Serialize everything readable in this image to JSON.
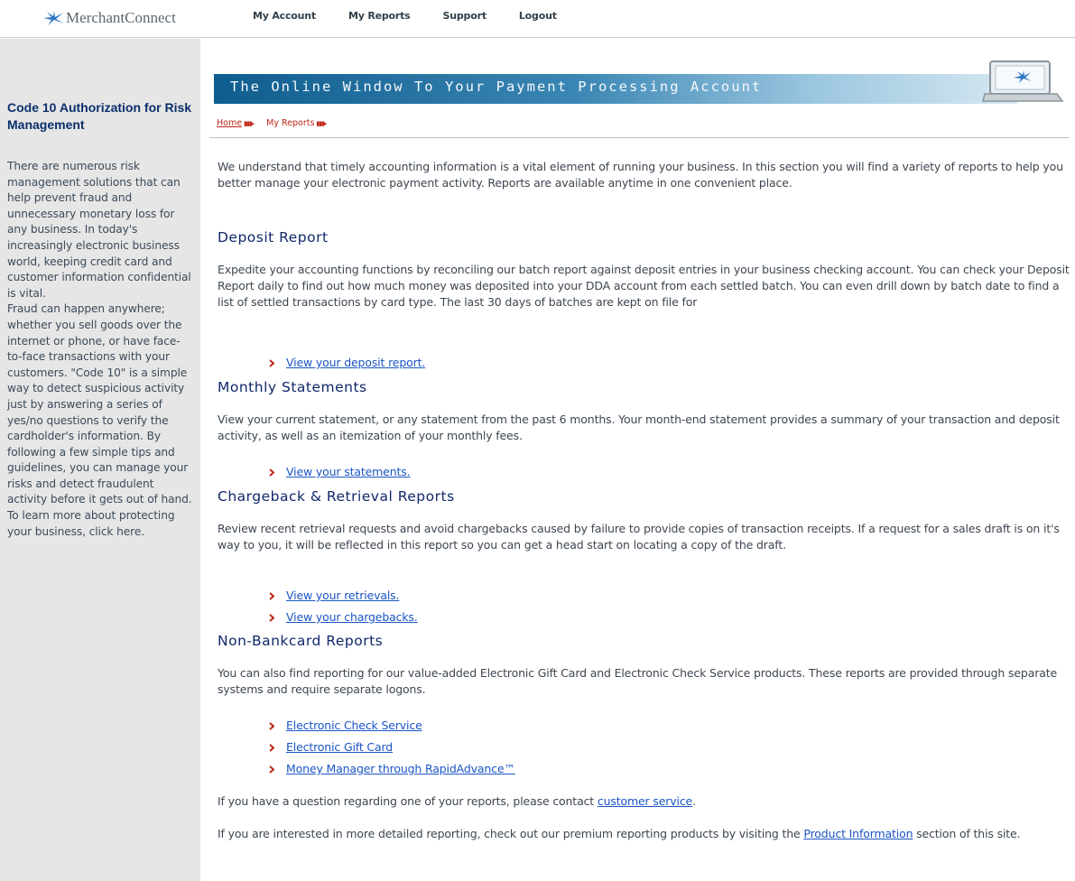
{
  "header": {
    "logo_text": "MerchantConnect",
    "nav": [
      "My Account",
      "My Reports",
      "Support",
      "Logout"
    ]
  },
  "sidebar": {
    "title": "Code 10 Authorization for Risk Management",
    "para1": "There are numerous risk management solutions that can help prevent fraud and unnecessary monetary loss for any business. In today's increasingly electronic business world, keeping credit card and customer information confidential is vital.",
    "para2": "Fraud can happen anywhere; whether you sell goods over the internet or phone, or have face-to-face transactions with your customers. \"Code 10\" is a simple way to detect suspicious activity just by answering a series of yes/no questions to verify the cardholder's information. By following a few simple tips and guidelines, you can manage your risks and detect fraudulent activity before it gets out of hand. To learn more about protecting your business, click here."
  },
  "banner": {
    "text": "The Online Window To Your Payment Processing Account"
  },
  "breadcrumb": {
    "home": "Home",
    "reports": "My Reports"
  },
  "main": {
    "intro": "We understand that timely accounting information is a vital element of running your business. In this section you will find a variety of reports to help you better manage your electronic payment activity. Reports are available anytime in one convenient place.",
    "deposit": {
      "heading": "Deposit Report",
      "body": "Expedite your accounting functions by reconciling our batch report against deposit entries in your business checking account. You can check your Deposit Report daily to find out how much money was deposited into your DDA account from each settled batch. You can even drill down by batch date to find a list of settled transactions by card type. The last 30 days of batches are kept on file for",
      "link": "View your deposit report."
    },
    "monthly": {
      "heading": "Monthly Statements",
      "body": "View your current statement, or any statement from the past 6 months. Your month-end statement provides a summary of your transaction and deposit activity, as well as an itemization of your monthly fees.",
      "link": "View your statements."
    },
    "chargeback": {
      "heading": "Chargeback & Retrieval Reports",
      "body": "Review recent retrieval requests and avoid chargebacks caused by failure to provide copies of transaction receipts. If a request for a sales draft is on it's way to you, it will be reflected in this report so you can get a head start on locating a copy of the draft.",
      "link1": "View your retrievals.",
      "link2": "View your chargebacks."
    },
    "nonbank": {
      "heading": "Non-Bankcard Reports",
      "body": "You can also find reporting for our value-added Electronic Gift Card and Electronic Check Service products. These reports are provided through separate systems and require separate logons.",
      "link1": "Electronic Check Service",
      "link2": "Electronic Gift Card",
      "link3": "Money Manager through RapidAdvance™"
    },
    "question": {
      "prefix": "If you have a question regarding one of your reports, please contact ",
      "link": "customer service",
      "suffix": "."
    },
    "premium": {
      "prefix": "If you are interested in more detailed reporting, check out our premium reporting products by visiting the ",
      "link": "Product Information",
      "suffix": " section of this site."
    }
  },
  "colors": {
    "nav_text": "#33404a",
    "sidebar_bg": "#e6e6e6",
    "sidebar_title": "#0a2f6b",
    "heading": "#10286a",
    "link": "#1a55c4",
    "breadcrumb": "#c0271a",
    "bullet": "#c0271a"
  },
  "icons": {
    "logo": "star-swoosh-icon",
    "bullet": "chevron-right-icon",
    "banner_device": "laptop-logo-icon"
  }
}
